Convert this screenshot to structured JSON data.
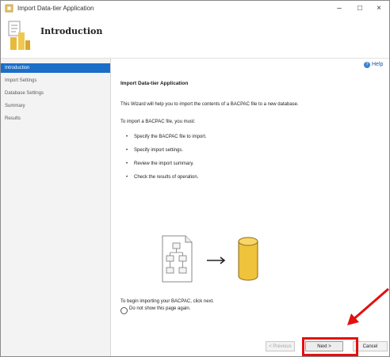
{
  "window": {
    "title": "Import Data-tier Application",
    "minimize_glyph": "–",
    "maximize_glyph": "□",
    "close_glyph": "×"
  },
  "header": {
    "title": "Introduction",
    "icon": "wizard-icon"
  },
  "sidebar": {
    "items": [
      {
        "label": "Introduction",
        "selected": true
      },
      {
        "label": "Import Settings"
      },
      {
        "label": "Database Settings"
      },
      {
        "label": "Summary"
      },
      {
        "label": "Results"
      }
    ]
  },
  "help": {
    "label": "Help",
    "icon": "help-icon"
  },
  "content": {
    "heading": "Import Data-tier Application",
    "intro": "This Wizard will help you to import the contents of a BACPAC file to a new database.",
    "steps_intro": "To import a BACPAC file, you must:",
    "steps": [
      "Specify the BACPAC file to import.",
      "Specify import settings.",
      "Review the import summary.",
      "Check the results of operation."
    ],
    "footer_text": "To begin importing your BACPAC, click next.",
    "checkbox_label": "Do not show this page again.",
    "illustration": {
      "file_icon": "document-diagram-icon",
      "arrow": "→",
      "db_icon": "database-icon"
    }
  },
  "buttons": {
    "previous": "< Previous",
    "next": "Next >",
    "cancel": "Cancel"
  },
  "annotation": {
    "highlight_color": "#e31010",
    "target": "next-button"
  },
  "colors": {
    "selection": "#1a6ec8",
    "accent_db": "#f0c33c"
  }
}
